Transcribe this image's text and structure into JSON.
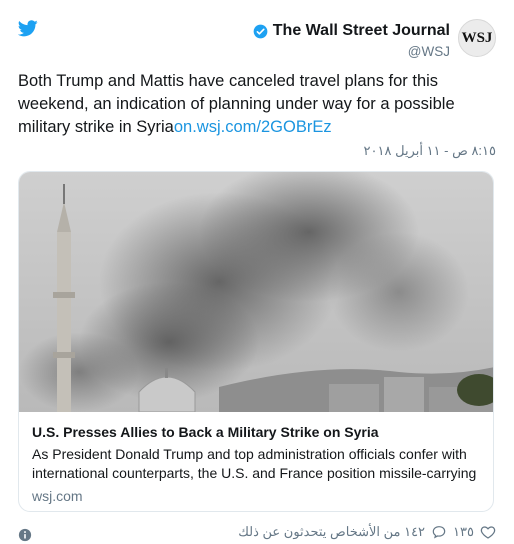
{
  "header": {
    "author_name": "The Wall Street Journal",
    "handle": "@WSJ",
    "avatar_text": "WSJ"
  },
  "tweet": {
    "text": "Both Trump and Mattis have canceled travel plans for this weekend, an indication of planning under way for a possible military strike in Syria",
    "link_text": "on.wsj.com/2GOBrEz",
    "timestamp": "٨:١٥ ص - ١١ أبريل ٢٠١٨"
  },
  "card": {
    "title": "U.S. Presses Allies to Back a Military Strike on Syria",
    "description": "As President Donald Trump and top administration officials confer with international counterparts, the U.S. and France position missile-carrying",
    "domain": "wsj.com"
  },
  "footer": {
    "likes": "١٣٥",
    "talking": "١٤٢ من الأشخاص يتحدثون عن ذلك"
  },
  "colors": {
    "brand": "#1da1f2",
    "link": "#1b95e0",
    "muted": "#657786"
  },
  "icons": {
    "logo": "twitter-bird-icon",
    "verified": "verified-badge-icon",
    "like": "heart-icon",
    "reply": "speech-bubble-icon",
    "info": "info-icon"
  }
}
